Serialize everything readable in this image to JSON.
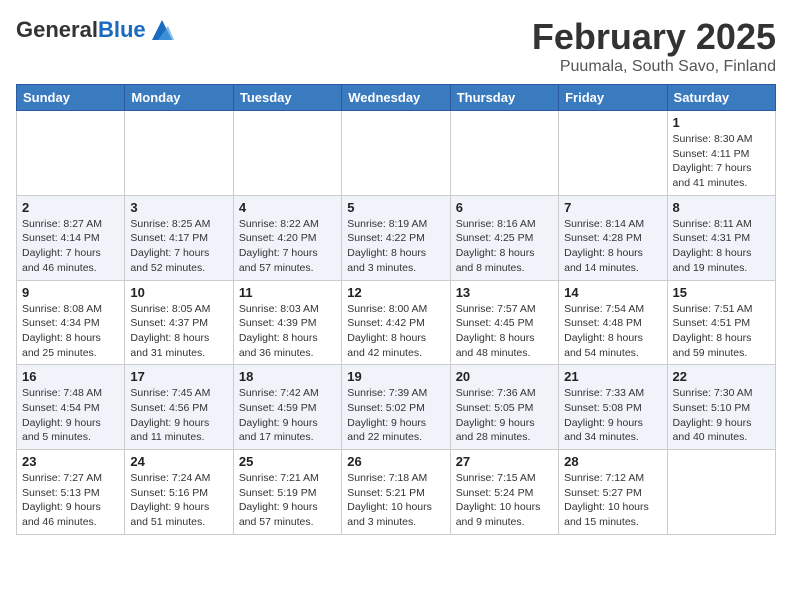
{
  "header": {
    "logo_general": "General",
    "logo_blue": "Blue",
    "month": "February 2025",
    "location": "Puumala, South Savo, Finland"
  },
  "days_of_week": [
    "Sunday",
    "Monday",
    "Tuesday",
    "Wednesday",
    "Thursday",
    "Friday",
    "Saturday"
  ],
  "weeks": [
    [
      {
        "day": "",
        "info": ""
      },
      {
        "day": "",
        "info": ""
      },
      {
        "day": "",
        "info": ""
      },
      {
        "day": "",
        "info": ""
      },
      {
        "day": "",
        "info": ""
      },
      {
        "day": "",
        "info": ""
      },
      {
        "day": "1",
        "info": "Sunrise: 8:30 AM\nSunset: 4:11 PM\nDaylight: 7 hours and 41 minutes."
      }
    ],
    [
      {
        "day": "2",
        "info": "Sunrise: 8:27 AM\nSunset: 4:14 PM\nDaylight: 7 hours and 46 minutes."
      },
      {
        "day": "3",
        "info": "Sunrise: 8:25 AM\nSunset: 4:17 PM\nDaylight: 7 hours and 52 minutes."
      },
      {
        "day": "4",
        "info": "Sunrise: 8:22 AM\nSunset: 4:20 PM\nDaylight: 7 hours and 57 minutes."
      },
      {
        "day": "5",
        "info": "Sunrise: 8:19 AM\nSunset: 4:22 PM\nDaylight: 8 hours and 3 minutes."
      },
      {
        "day": "6",
        "info": "Sunrise: 8:16 AM\nSunset: 4:25 PM\nDaylight: 8 hours and 8 minutes."
      },
      {
        "day": "7",
        "info": "Sunrise: 8:14 AM\nSunset: 4:28 PM\nDaylight: 8 hours and 14 minutes."
      },
      {
        "day": "8",
        "info": "Sunrise: 8:11 AM\nSunset: 4:31 PM\nDaylight: 8 hours and 19 minutes."
      }
    ],
    [
      {
        "day": "9",
        "info": "Sunrise: 8:08 AM\nSunset: 4:34 PM\nDaylight: 8 hours and 25 minutes."
      },
      {
        "day": "10",
        "info": "Sunrise: 8:05 AM\nSunset: 4:37 PM\nDaylight: 8 hours and 31 minutes."
      },
      {
        "day": "11",
        "info": "Sunrise: 8:03 AM\nSunset: 4:39 PM\nDaylight: 8 hours and 36 minutes."
      },
      {
        "day": "12",
        "info": "Sunrise: 8:00 AM\nSunset: 4:42 PM\nDaylight: 8 hours and 42 minutes."
      },
      {
        "day": "13",
        "info": "Sunrise: 7:57 AM\nSunset: 4:45 PM\nDaylight: 8 hours and 48 minutes."
      },
      {
        "day": "14",
        "info": "Sunrise: 7:54 AM\nSunset: 4:48 PM\nDaylight: 8 hours and 54 minutes."
      },
      {
        "day": "15",
        "info": "Sunrise: 7:51 AM\nSunset: 4:51 PM\nDaylight: 8 hours and 59 minutes."
      }
    ],
    [
      {
        "day": "16",
        "info": "Sunrise: 7:48 AM\nSunset: 4:54 PM\nDaylight: 9 hours and 5 minutes."
      },
      {
        "day": "17",
        "info": "Sunrise: 7:45 AM\nSunset: 4:56 PM\nDaylight: 9 hours and 11 minutes."
      },
      {
        "day": "18",
        "info": "Sunrise: 7:42 AM\nSunset: 4:59 PM\nDaylight: 9 hours and 17 minutes."
      },
      {
        "day": "19",
        "info": "Sunrise: 7:39 AM\nSunset: 5:02 PM\nDaylight: 9 hours and 22 minutes."
      },
      {
        "day": "20",
        "info": "Sunrise: 7:36 AM\nSunset: 5:05 PM\nDaylight: 9 hours and 28 minutes."
      },
      {
        "day": "21",
        "info": "Sunrise: 7:33 AM\nSunset: 5:08 PM\nDaylight: 9 hours and 34 minutes."
      },
      {
        "day": "22",
        "info": "Sunrise: 7:30 AM\nSunset: 5:10 PM\nDaylight: 9 hours and 40 minutes."
      }
    ],
    [
      {
        "day": "23",
        "info": "Sunrise: 7:27 AM\nSunset: 5:13 PM\nDaylight: 9 hours and 46 minutes."
      },
      {
        "day": "24",
        "info": "Sunrise: 7:24 AM\nSunset: 5:16 PM\nDaylight: 9 hours and 51 minutes."
      },
      {
        "day": "25",
        "info": "Sunrise: 7:21 AM\nSunset: 5:19 PM\nDaylight: 9 hours and 57 minutes."
      },
      {
        "day": "26",
        "info": "Sunrise: 7:18 AM\nSunset: 5:21 PM\nDaylight: 10 hours and 3 minutes."
      },
      {
        "day": "27",
        "info": "Sunrise: 7:15 AM\nSunset: 5:24 PM\nDaylight: 10 hours and 9 minutes."
      },
      {
        "day": "28",
        "info": "Sunrise: 7:12 AM\nSunset: 5:27 PM\nDaylight: 10 hours and 15 minutes."
      },
      {
        "day": "",
        "info": ""
      }
    ]
  ]
}
